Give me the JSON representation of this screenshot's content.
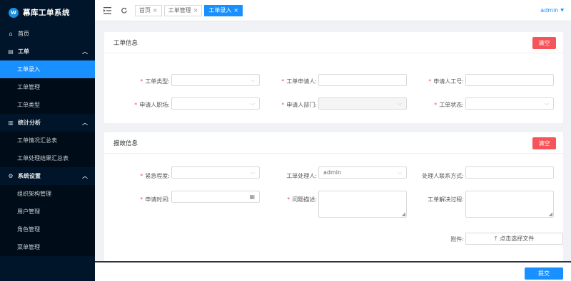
{
  "app": {
    "title": "幕库工单系统",
    "logo_text": "W"
  },
  "sidebar": {
    "home": "首页",
    "groups": [
      {
        "label": "工单",
        "items": [
          "工单录入",
          "工单管理",
          "工单类型"
        ]
      },
      {
        "label": "统计分析",
        "items": [
          "工单情况汇总表",
          "工单处理结果汇总表"
        ]
      },
      {
        "label": "系统设置",
        "items": [
          "组织架构管理",
          "用户管理",
          "角色管理",
          "菜单管理"
        ]
      }
    ]
  },
  "header": {
    "tabs": [
      {
        "label": "首页",
        "close": "×"
      },
      {
        "label": "工单管理",
        "close": "×"
      },
      {
        "label": "工单录入",
        "close": "×"
      }
    ],
    "user": "admin"
  },
  "ticket_info": {
    "title": "工单信息",
    "clear_label": "清空",
    "fields": {
      "type": {
        "label": "工单类型:",
        "value": ""
      },
      "applicant": {
        "label": "工单申请人:",
        "value": ""
      },
      "employee_id": {
        "label": "申请人工号:",
        "value": ""
      },
      "position": {
        "label": "申请人职场:",
        "value": ""
      },
      "department": {
        "label": "申请人部门:",
        "value": ""
      },
      "status": {
        "label": "工单状态:",
        "value": ""
      }
    }
  },
  "fault_info": {
    "title": "报故信息",
    "clear_label": "清空",
    "fields": {
      "urgency": {
        "label": "紧急程度:",
        "value": ""
      },
      "handler": {
        "label": "工单处理人:",
        "value": "admin"
      },
      "handler_contact": {
        "label": "处理人联系方式:",
        "value": ""
      },
      "apply_time": {
        "label": "申请时间:",
        "value": ""
      },
      "description": {
        "label": "问题描述:",
        "value": ""
      },
      "resolution": {
        "label": "工单解决过程:",
        "value": ""
      },
      "attachment": {
        "label": "附件:",
        "button": "点击选择文件"
      }
    }
  },
  "footer": {
    "submit_label": "提交"
  },
  "colors": {
    "sidebar_bg": "#001529",
    "accent": "#1890ff",
    "danger": "#f5545a"
  }
}
